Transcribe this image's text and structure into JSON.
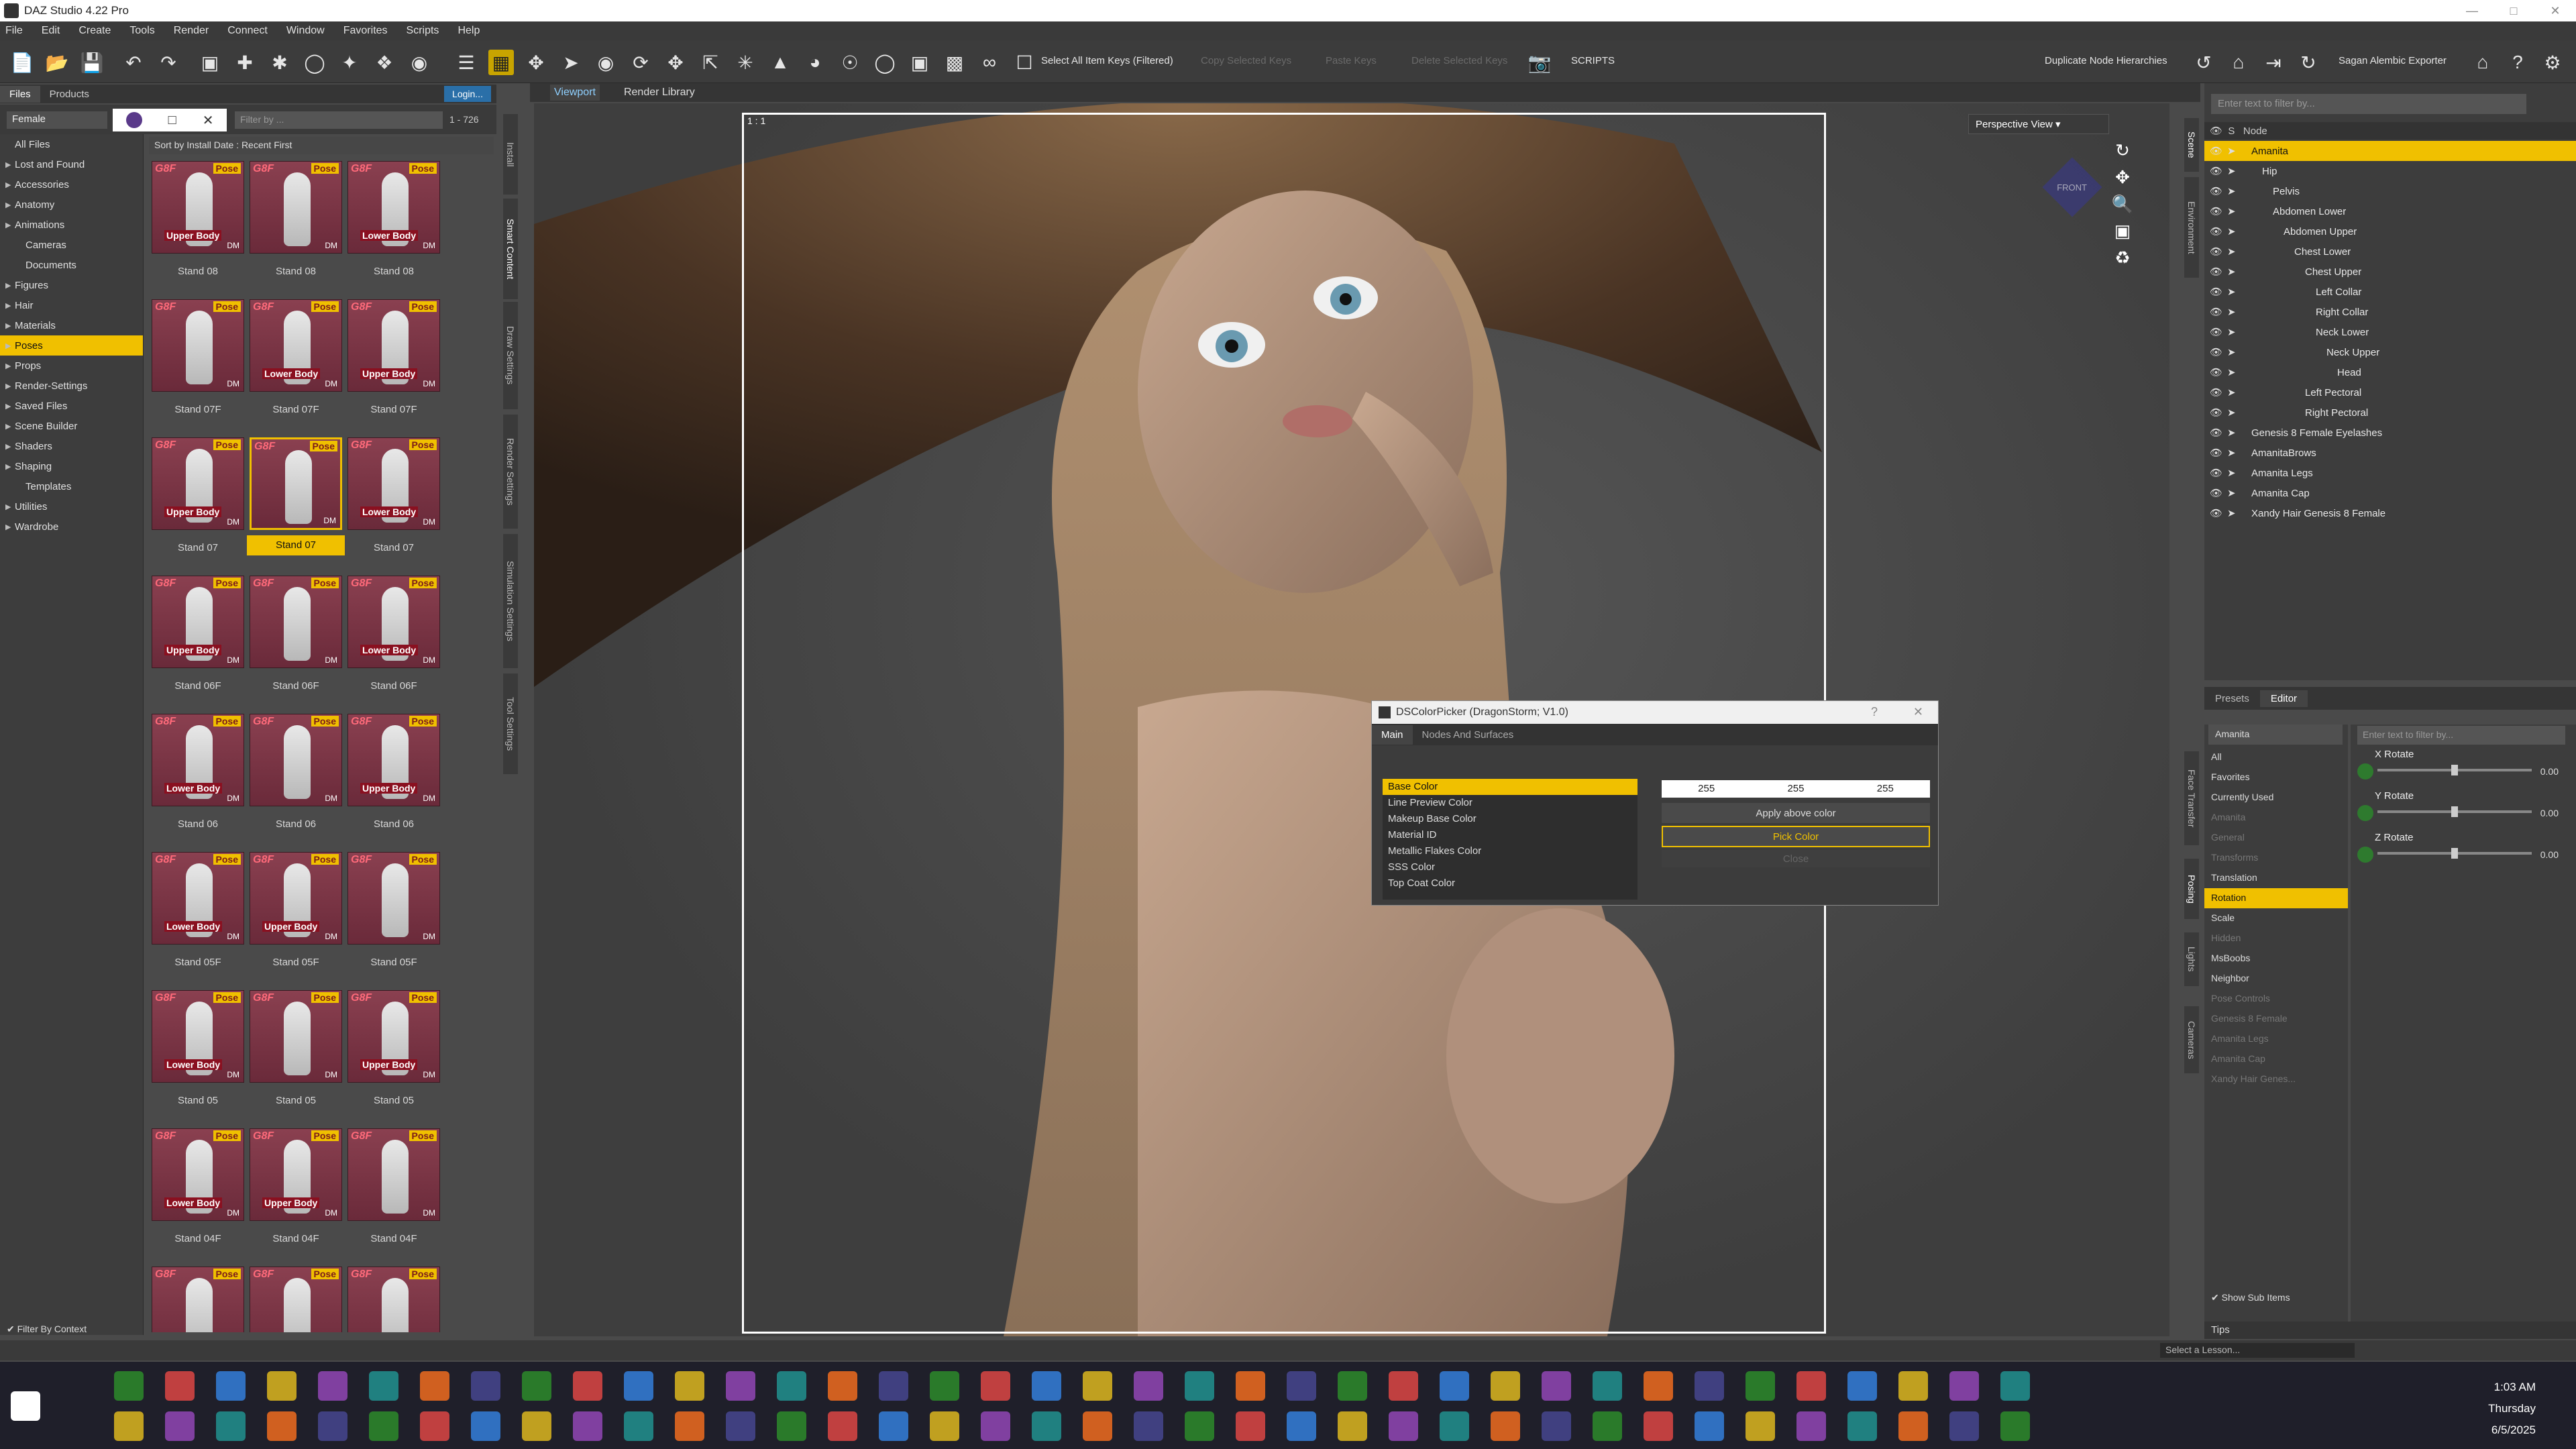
{
  "window": {
    "title": "DAZ Studio 4.22 Pro"
  },
  "menubar": [
    "File",
    "Edit",
    "Create",
    "Tools",
    "Render",
    "Connect",
    "Window",
    "Favorites",
    "Scripts",
    "Help"
  ],
  "toolbar": {
    "select_keys": "Select All Item Keys (Filtered)",
    "dim1": "Copy Selected Keys",
    "dim2": "Paste Keys",
    "dim3": "Delete Selected Keys",
    "scripts": "SCRIPTS",
    "duplicate": "Duplicate Node Hierarchies",
    "exporter": "Sagan Alembic Exporter"
  },
  "left_panel": {
    "tabs": [
      "Files",
      "Products"
    ],
    "login": "Login...",
    "filter_combo": "Female",
    "filter_placeholder": "Filter by ...",
    "count": "1 - 726",
    "sort": "Sort by Install Date : Recent First",
    "filter_by_context": "Filter By Context",
    "categories": [
      {
        "label": "All Files",
        "arrow": "",
        "indent": false
      },
      {
        "label": "Lost and Found",
        "arrow": "▶",
        "indent": false
      },
      {
        "label": "Accessories",
        "arrow": "▶",
        "indent": false
      },
      {
        "label": "Anatomy",
        "arrow": "▶",
        "indent": false
      },
      {
        "label": "Animations",
        "arrow": "▶",
        "indent": false
      },
      {
        "label": "Cameras",
        "arrow": "",
        "indent": true
      },
      {
        "label": "Documents",
        "arrow": "",
        "indent": true
      },
      {
        "label": "Figures",
        "arrow": "▶",
        "indent": false
      },
      {
        "label": "Hair",
        "arrow": "▶",
        "indent": false
      },
      {
        "label": "Materials",
        "arrow": "▶",
        "indent": false
      },
      {
        "label": "Poses",
        "arrow": "▶",
        "indent": false,
        "active": true
      },
      {
        "label": "Props",
        "arrow": "▶",
        "indent": false
      },
      {
        "label": "Render-Settings",
        "arrow": "▶",
        "indent": false
      },
      {
        "label": "Saved Files",
        "arrow": "▶",
        "indent": false
      },
      {
        "label": "Scene Builder",
        "arrow": "▶",
        "indent": false
      },
      {
        "label": "Shaders",
        "arrow": "▶",
        "indent": false
      },
      {
        "label": "Shaping",
        "arrow": "▶",
        "indent": false
      },
      {
        "label": "Templates",
        "arrow": "",
        "indent": true
      },
      {
        "label": "Utilities",
        "arrow": "▶",
        "indent": false
      },
      {
        "label": "Wardrobe",
        "arrow": "▶",
        "indent": false
      }
    ],
    "thumbs": [
      {
        "label": "Stand 08",
        "body": "Upper Body"
      },
      {
        "label": "Stand 08",
        "body": ""
      },
      {
        "label": "Stand 08",
        "body": "Lower Body"
      },
      {
        "label": "Stand 07F",
        "body": ""
      },
      {
        "label": "Stand 07F",
        "body": "Lower Body"
      },
      {
        "label": "Stand 07F",
        "body": "Upper Body"
      },
      {
        "label": "Stand 07",
        "body": "Upper Body"
      },
      {
        "label": "Stand 07",
        "body": "",
        "selected": true
      },
      {
        "label": "Stand 07",
        "body": "Lower Body"
      },
      {
        "label": "Stand 06F",
        "body": "Upper Body"
      },
      {
        "label": "Stand 06F",
        "body": ""
      },
      {
        "label": "Stand 06F",
        "body": "Lower Body"
      },
      {
        "label": "Stand 06",
        "body": "Lower Body"
      },
      {
        "label": "Stand 06",
        "body": ""
      },
      {
        "label": "Stand 06",
        "body": "Upper Body"
      },
      {
        "label": "Stand 05F",
        "body": "Lower Body"
      },
      {
        "label": "Stand 05F",
        "body": "Upper Body"
      },
      {
        "label": "Stand 05F",
        "body": ""
      },
      {
        "label": "Stand 05",
        "body": "Lower Body"
      },
      {
        "label": "Stand 05",
        "body": ""
      },
      {
        "label": "Stand 05",
        "body": "Upper Body"
      },
      {
        "label": "Stand 04F",
        "body": "Lower Body"
      },
      {
        "label": "Stand 04F",
        "body": "Upper Body"
      },
      {
        "label": "Stand 04F",
        "body": ""
      },
      {
        "label": "",
        "body": "Lower Body"
      },
      {
        "label": "",
        "body": ""
      },
      {
        "label": "",
        "body": ""
      }
    ],
    "g8f": "G8F",
    "pose_tag": "Pose",
    "dm": "DM"
  },
  "side_tabs_left": [
    "Install",
    "Smart Content",
    "Draw Settings",
    "Render Settings",
    "Simulation Settings",
    "Tool Settings"
  ],
  "viewport": {
    "tabs": [
      "Viewport",
      "Render Library"
    ],
    "ratio": "1 : 1",
    "camera": "Perspective View",
    "cube_label": "FRONT"
  },
  "color_dialog": {
    "title": "DSColorPicker (DragonStorm; V1.0)",
    "tabs": [
      "Main",
      "Nodes And Surfaces"
    ],
    "properties": [
      "Base Color",
      "Line Preview Color",
      "Makeup Base Color",
      "Material ID",
      "Metallic Flakes Color",
      "SSS Color",
      "Top Coat Color"
    ],
    "r": "255",
    "g": "255",
    "b": "255",
    "apply": "Apply above color",
    "pick": "Pick Color",
    "close": "Close"
  },
  "scene": {
    "filter_placeholder": "Enter text to filter by...",
    "header": "Node",
    "nodes": [
      {
        "name": "Amanita",
        "depth": 0,
        "active": true
      },
      {
        "name": "Hip",
        "depth": 1
      },
      {
        "name": "Pelvis",
        "depth": 2
      },
      {
        "name": "Abdomen Lower",
        "depth": 2
      },
      {
        "name": "Abdomen Upper",
        "depth": 3
      },
      {
        "name": "Chest Lower",
        "depth": 4
      },
      {
        "name": "Chest Upper",
        "depth": 5
      },
      {
        "name": "Left Collar",
        "depth": 6
      },
      {
        "name": "Right Collar",
        "depth": 6
      },
      {
        "name": "Neck Lower",
        "depth": 6
      },
      {
        "name": "Neck Upper",
        "depth": 7
      },
      {
        "name": "Head",
        "depth": 8
      },
      {
        "name": "Left Pectoral",
        "depth": 5
      },
      {
        "name": "Right Pectoral",
        "depth": 5
      },
      {
        "name": "Genesis 8 Female Eyelashes",
        "depth": 0
      },
      {
        "name": "AmanitaBrows",
        "depth": 0
      },
      {
        "name": "Amanita Legs",
        "depth": 0
      },
      {
        "name": "Amanita Cap",
        "depth": 0
      },
      {
        "name": "Xandy Hair Genesis 8 Female",
        "depth": 0
      }
    ],
    "tabs": [
      "Tips",
      "Node"
    ]
  },
  "side_tabs_right": [
    "Scene",
    "Environment",
    "Face Transfer",
    "Posing",
    "Lights",
    "Cameras"
  ],
  "params": {
    "tabs": [
      "Presets",
      "Editor"
    ],
    "node_combo": "Amanita",
    "filter_placeholder": "Enter text to filter by...",
    "list": [
      {
        "label": "All"
      },
      {
        "label": "Favorites"
      },
      {
        "label": "Currently Used"
      },
      {
        "label": "Amanita",
        "dim": true
      },
      {
        "label": "General",
        "dim": true
      },
      {
        "label": "Transforms",
        "dim": true
      },
      {
        "label": "Translation"
      },
      {
        "label": "Rotation",
        "active": true
      },
      {
        "label": "Scale"
      },
      {
        "label": "Hidden",
        "dim": true
      },
      {
        "label": "MsBoobs"
      },
      {
        "label": "Neighbor"
      },
      {
        "label": "Pose Controls",
        "dim": true
      },
      {
        "label": "Genesis 8 Female",
        "dim": true
      },
      {
        "label": "Amanita Legs",
        "dim": true
      },
      {
        "label": "Amanita Cap",
        "dim": true
      },
      {
        "label": "Xandy Hair Genes...",
        "dim": true
      }
    ],
    "sliders": [
      {
        "label": "X Rotate",
        "value": "0.00"
      },
      {
        "label": "Y Rotate",
        "value": "0.00"
      },
      {
        "label": "Z Rotate",
        "value": "0.00"
      }
    ],
    "show_sub": "Show Sub Items"
  },
  "tips": "Tips",
  "lesson": "Select a Lesson...",
  "clock": {
    "time": "1:03 AM",
    "day": "Thursday",
    "date": "6/5/2025"
  },
  "colors": {
    "accent": "#f0c000",
    "bg": "#3d3d3d",
    "link": "#8fd0ff"
  }
}
